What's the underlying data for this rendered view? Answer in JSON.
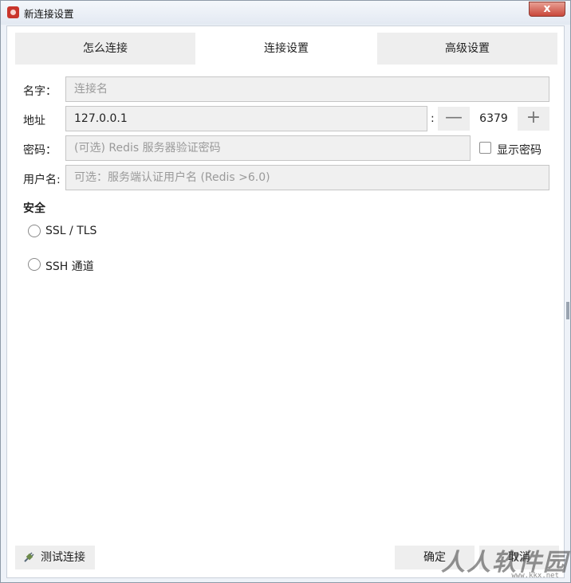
{
  "window": {
    "title": "新连接设置",
    "close_glyph": "x"
  },
  "tabs": [
    {
      "label": "怎么连接",
      "active": false
    },
    {
      "label": "连接设置",
      "active": true
    },
    {
      "label": "高级设置",
      "active": false
    }
  ],
  "form": {
    "name": {
      "label": "名字：",
      "placeholder": "连接名",
      "value": ""
    },
    "address": {
      "label": "地址",
      "value": "127.0.0.1",
      "separator": ":"
    },
    "port": {
      "value": "6379",
      "decrement_glyph": "—",
      "increment_glyph": "+"
    },
    "password": {
      "label": "密码：",
      "placeholder": "(可选) Redis 服务器验证密码",
      "show_password_label": "显示密码",
      "show_password_checked": false
    },
    "username": {
      "label": "用户名:",
      "placeholder": "可选：服务端认证用户名 (Redis >6.0)"
    }
  },
  "security": {
    "title": "安全",
    "options": [
      {
        "label": "SSL / TLS",
        "selected": false
      },
      {
        "label": "SSH 通道",
        "selected": false
      }
    ]
  },
  "footer": {
    "test_connection_label": "测试连接",
    "ok_label": "确定",
    "cancel_label": "取消"
  },
  "watermark": {
    "text": "人人软件园",
    "url": "www.kkx.net"
  },
  "colors": {
    "tab_inactive": "#eeeeee",
    "input_bg": "#f0f0f0",
    "close_button": "#c9473a",
    "app_icon": "#c9352b"
  }
}
